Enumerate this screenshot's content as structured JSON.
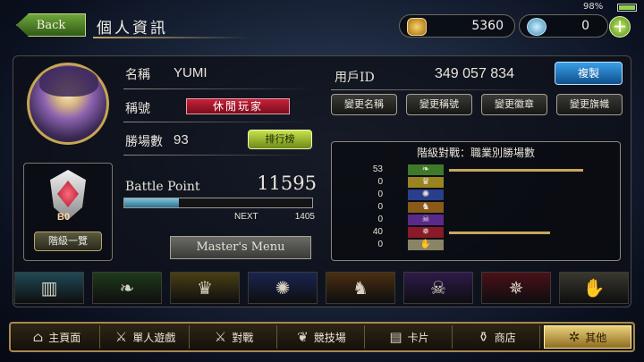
{
  "status": {
    "battery": "98%"
  },
  "header": {
    "back_label": "Back",
    "title": "個人資訊"
  },
  "currency": {
    "coins": "5360",
    "crystals": "0",
    "plus": "+"
  },
  "profile": {
    "name_label": "名稱",
    "name_value": "YUMI",
    "title_label": "稱號",
    "title_value": "休閒玩家",
    "wins_label": "勝場數",
    "wins_value": "93",
    "ranking_button": "排行榜",
    "battle_point_label": "Battle Point",
    "battle_point_value": "11595",
    "next_label": "NEXT",
    "next_value": "1405",
    "progress": 0.29,
    "rank_badge": "B0",
    "rank_list_button": "階級一覽",
    "master_menu": "Master's Menu"
  },
  "account": {
    "user_id_label": "用戶ID",
    "user_id_value": "349 057 834",
    "copy_button": "複製",
    "buttons": [
      "變更名稱",
      "變更稱號",
      "變更徽章",
      "變更旗幟"
    ]
  },
  "class_wins": {
    "title": "階級對戰：職業別勝場數",
    "rows": [
      {
        "value": 53,
        "color": "#3f7a2a",
        "icon": "leaf-icon"
      },
      {
        "value": 0,
        "color": "#9a8420",
        "icon": "crown-icon"
      },
      {
        "value": 0,
        "color": "#2a3f8a",
        "icon": "star-icon"
      },
      {
        "value": 0,
        "color": "#8a5a1a",
        "icon": "dragon-icon"
      },
      {
        "value": 0,
        "color": "#5a2a8a",
        "icon": "skull-icon"
      },
      {
        "value": 40,
        "color": "#8a1a2a",
        "icon": "bat-icon"
      },
      {
        "value": 0,
        "color": "#8a8466",
        "icon": "claw-icon"
      }
    ]
  },
  "class_tabs": [
    {
      "icon": "cards-icon",
      "color": "#1f4a55"
    },
    {
      "icon": "leaf-icon",
      "color": "#1e3a1a"
    },
    {
      "icon": "crown-icon",
      "color": "#4a3f12"
    },
    {
      "icon": "star-icon",
      "color": "#1a2550"
    },
    {
      "icon": "dragon-icon",
      "color": "#4a2e10"
    },
    {
      "icon": "skull-icon",
      "color": "#2e1a4a"
    },
    {
      "icon": "bat-icon",
      "color": "#4a1018"
    },
    {
      "icon": "claw-icon",
      "color": "#3a382e"
    }
  ],
  "nav": [
    "主頁面",
    "單人遊戲",
    "對戰",
    "競技場",
    "卡片",
    "商店",
    "其他"
  ]
}
